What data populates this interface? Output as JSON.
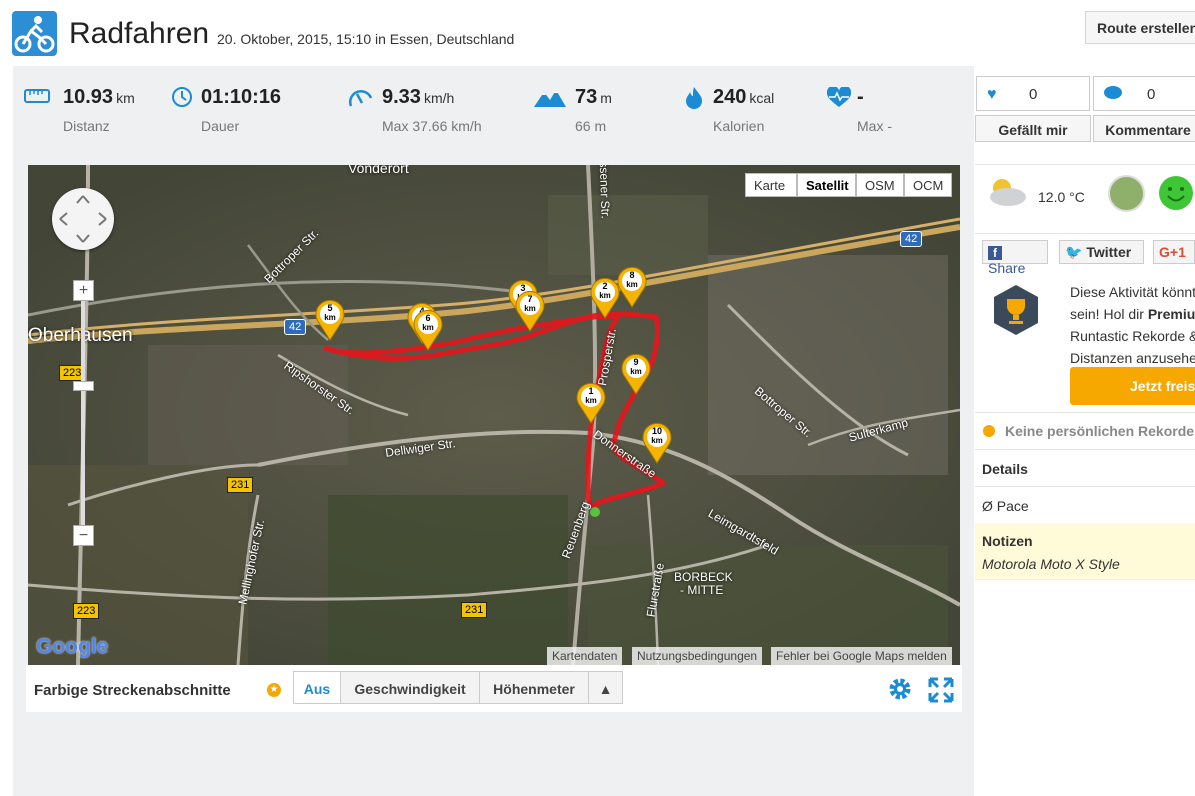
{
  "header": {
    "title": "Radfahren",
    "subtitle": "20. Oktober, 2015, 15:10 in Essen, Deutschland",
    "route_button": "Route erstellen"
  },
  "stats": [
    {
      "icon": "ruler-icon",
      "value": "10.93",
      "unit": "km",
      "label": "Distanz"
    },
    {
      "icon": "clock-icon",
      "value": "01:10:16",
      "unit": "",
      "label": "Dauer"
    },
    {
      "icon": "speedometer-icon",
      "value": "9.33",
      "unit": "km/h",
      "label": "Max 37.66 km/h"
    },
    {
      "icon": "mountain-icon",
      "value": "73",
      "unit": "m",
      "label": "66 m"
    },
    {
      "icon": "flame-icon",
      "value": "240",
      "unit": "kcal",
      "label": "Kalorien"
    },
    {
      "icon": "heart-rate-icon",
      "value": "-",
      "unit": "",
      "label": "Max -"
    }
  ],
  "map": {
    "types": [
      "Karte",
      "Satellit",
      "OSM",
      "OCM"
    ],
    "selected_type": "Satellit",
    "footer": [
      "Kartendaten",
      "Nutzungsbedingungen",
      "Fehler bei Google Maps melden"
    ],
    "labels": {
      "oberhausen": "Oberhausen",
      "vonderort": "Vonderort",
      "bottroper1": "Bottroper Str.",
      "bottroper2": "Bottroper Str.",
      "ripshorster": "Ripshorster Str.",
      "dellwiger": "Dellwiger Str.",
      "sulterkamp": "Sulterkamp",
      "leimgardtsfeld": "Leimgardtsfeld",
      "mellinghofer": "Mellinghofer Str.",
      "flurstrasse": "Flurstraße",
      "borbeck1": "BORBECK",
      "borbeck2": "- MITTE",
      "reuenberg": "Reuenberg",
      "donnerstr": "Donnerstraße",
      "prosperstr": "Prosperstr.",
      "essener": "ssener Str.",
      "r42a": "42",
      "r42b": "42",
      "r223a": "223",
      "r223b": "223",
      "r231a": "231",
      "r231b": "231",
      "google": "Google"
    },
    "markers": [
      "1",
      "2",
      "3",
      "4",
      "5",
      "6",
      "7",
      "8",
      "9",
      "10"
    ],
    "marker_unit": "km"
  },
  "segments": {
    "title": "Farbige Streckenabschnitte",
    "buttons": [
      "Aus",
      "Geschwindigkeit",
      "Höhenmeter"
    ],
    "active": "Aus",
    "collapse": "▲"
  },
  "social": {
    "likes": "0",
    "comments": "0",
    "like_label": "Gefällt mir",
    "comment_label": "Kommentare"
  },
  "weather": {
    "temperature": "12.0 °C"
  },
  "share": {
    "facebook": "Share",
    "twitter": "Twitter",
    "gplus": "G+1"
  },
  "promo": {
    "line1": "Diese Aktivität könnt",
    "line2a": "sein! Hol dir ",
    "line2b": "Premiu",
    "line3": "Runtastic Rekorde &",
    "line4": "Distanzen anzusehe",
    "button": "Jetzt freis"
  },
  "records": "Keine persönlichen Rekorde",
  "details": {
    "title": "Details",
    "pace_label": "Ø Pace"
  },
  "notes": {
    "title": "Notizen",
    "text": "Motorola Moto X Style"
  },
  "colors": {
    "accent": "#1b8bd3",
    "route": "#e8141b",
    "marker": "#f5b400",
    "premium": "#f6a800"
  }
}
